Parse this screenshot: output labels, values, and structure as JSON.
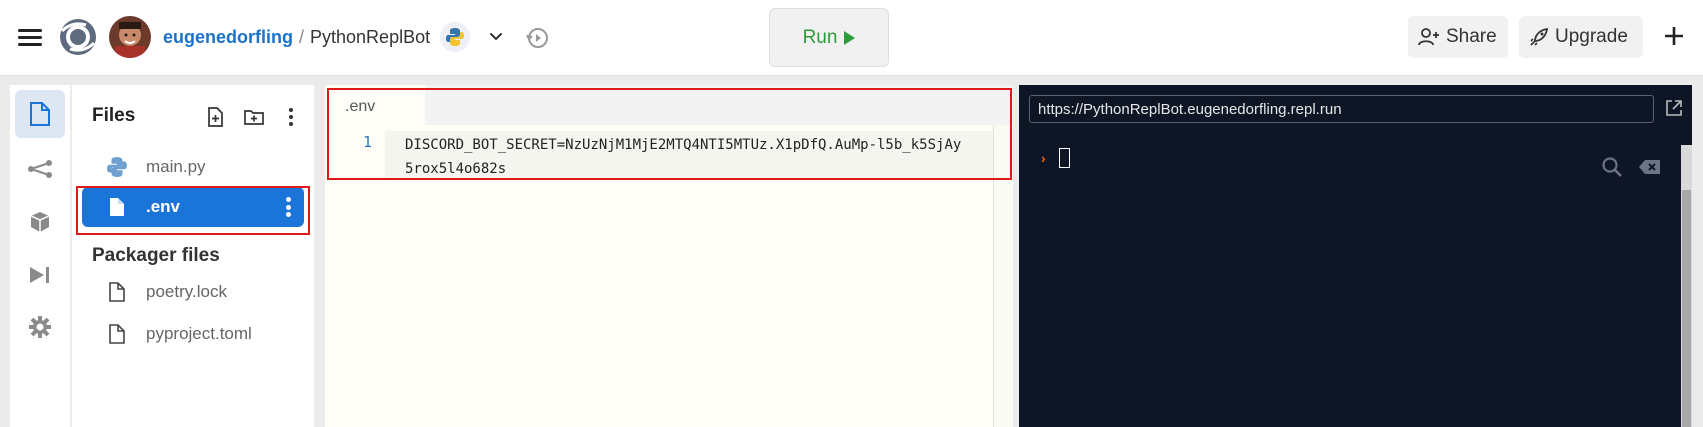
{
  "header": {
    "owner": "eugenedorfling",
    "separator": "/",
    "repl_name": "PythonReplBot",
    "run_label": "Run",
    "share_label": "Share",
    "upgrade_label": "Upgrade"
  },
  "sidebar": {
    "active_tool": "files",
    "tools": [
      "files-icon",
      "share-nodes-icon",
      "package-icon",
      "debugger-icon",
      "settings-icon"
    ]
  },
  "files": {
    "title": "Files",
    "items": [
      {
        "name": "main.py",
        "icon": "python-icon",
        "selected": false
      },
      {
        "name": ".env",
        "icon": "file-icon",
        "selected": true
      }
    ],
    "packager_title": "Packager files",
    "packager_items": [
      {
        "name": "poetry.lock",
        "icon": "file-icon"
      },
      {
        "name": "pyproject.toml",
        "icon": "file-icon"
      }
    ]
  },
  "editor": {
    "tab_label": ".env",
    "line_number": "1",
    "code": "DISCORD_BOT_SECRET=NzUzNjM1MjE2MTQ4NTI5MTUz.X1pDfQ.AuMp-l5b_k5SjAy5rox5l4o682s"
  },
  "console": {
    "url": "https://PythonReplBot.eugenedorfling.repl.run",
    "prompt": "›"
  },
  "colors": {
    "accent": "#1b74d8",
    "run_green": "#2e9b3a",
    "console_bg": "#0e1525",
    "highlight_red": "#e01919"
  }
}
